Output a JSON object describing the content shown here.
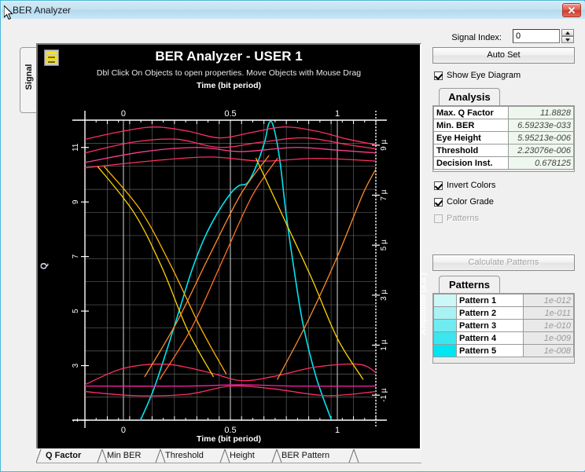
{
  "window": {
    "title": "BER Analyzer",
    "close_label": "Close",
    "accent_border": "#4ab8d8"
  },
  "left_tab": {
    "label": "Signal"
  },
  "plot": {
    "icon_name": "legend-properties-icon",
    "title": "BER Analyzer - USER 1",
    "subtitle": "Dbl Click On Objects to open properties.  Move Objects with Mouse Drag",
    "axis_top_title": "Time (bit period)",
    "axis_bottom_title": "Time (bit period)",
    "axis_left_title": "Q",
    "axis_right_title": "Amplitude (a.u.)",
    "background": "#000000",
    "grid_color": "#707070",
    "xticks": [
      "0",
      "0.5",
      "1"
    ],
    "yticks_left": [
      "1",
      "3",
      "5",
      "7",
      "9",
      "11"
    ],
    "yticks_right": [
      "-1 µ",
      "1 µ",
      "3 µ",
      "5 µ",
      "7 µ",
      "9 µ"
    ]
  },
  "chart_data": {
    "type": "line",
    "title": "BER Analyzer - USER 1",
    "subtitle": "Dbl Click On Objects to open properties.  Move Objects with Mouse Drag",
    "xlabel": "Time (bit period)",
    "ylabel": "Q",
    "y2label": "Amplitude (a.u.)",
    "xlim": [
      -0.18,
      1.18
    ],
    "ylim": [
      1,
      12
    ],
    "y2lim": [
      -2.0,
      10.0
    ],
    "xticks": [
      0,
      0.5,
      1
    ],
    "yticks": [
      1,
      3,
      5,
      7,
      9,
      11
    ],
    "y2ticks": [
      -1,
      1,
      3,
      5,
      7,
      9
    ],
    "grid": true,
    "legend": "none",
    "series": [
      {
        "name": "q-factor-curve",
        "color": "#00e5ee",
        "x": [
          0.08,
          0.14,
          0.2,
          0.26,
          0.32,
          0.38,
          0.44,
          0.5,
          0.54,
          0.58,
          0.62,
          0.66,
          0.68,
          0.7,
          0.73,
          0.76,
          0.8,
          0.84,
          0.9,
          0.97
        ],
        "y": [
          1.0,
          2.1,
          3.5,
          5.0,
          6.5,
          7.7,
          8.6,
          9.3,
          9.6,
          9.7,
          10.3,
          11.2,
          11.88,
          11.8,
          10.6,
          8.6,
          6.4,
          4.5,
          2.6,
          1.05
        ]
      },
      {
        "name": "eye-upper-rail-1",
        "color": "#ff2e63",
        "x": [
          -0.18,
          0.0,
          0.15,
          0.3,
          0.45,
          0.6,
          0.75,
          0.9,
          1.05,
          1.18
        ],
        "y": [
          11.3,
          11.6,
          11.75,
          11.6,
          11.35,
          11.55,
          11.75,
          11.6,
          11.3,
          11.1
        ]
      },
      {
        "name": "eye-upper-rail-2",
        "color": "#ff2e63",
        "x": [
          -0.18,
          0.05,
          0.25,
          0.45,
          0.65,
          0.85,
          1.05,
          1.18
        ],
        "y": [
          10.8,
          11.2,
          11.3,
          11.0,
          11.2,
          11.35,
          11.1,
          10.95
        ]
      },
      {
        "name": "eye-upper-rail-3",
        "color": "#ff3d8f",
        "x": [
          -0.18,
          0.1,
          0.35,
          0.55,
          0.8,
          1.0,
          1.18
        ],
        "y": [
          10.45,
          10.85,
          11.0,
          10.85,
          11.0,
          10.9,
          10.8
        ]
      },
      {
        "name": "eye-upper-rail-4",
        "color": "#ff2e63",
        "x": [
          -0.18,
          0.12,
          0.4,
          0.65,
          0.9,
          1.18
        ],
        "y": [
          10.25,
          10.5,
          10.65,
          10.5,
          10.6,
          10.5
        ]
      },
      {
        "name": "eye-lower-rail-1",
        "color": "#ff2e63",
        "x": [
          -0.18,
          0.0,
          0.2,
          0.4,
          0.55,
          0.7,
          0.9,
          1.1,
          1.18
        ],
        "y": [
          2.3,
          2.9,
          3.05,
          2.75,
          2.45,
          2.6,
          2.95,
          3.05,
          2.75
        ]
      },
      {
        "name": "eye-lower-rail-2",
        "color": "#ff2e63",
        "x": [
          -0.18,
          0.05,
          0.3,
          0.5,
          0.7,
          0.95,
          1.18
        ],
        "y": [
          2.05,
          1.9,
          1.95,
          2.25,
          2.15,
          1.9,
          2.05
        ]
      },
      {
        "name": "eye-lower-rail-3",
        "color": "#ff22aa",
        "x": [
          -0.18,
          0.3,
          0.55,
          0.8,
          1.18
        ],
        "y": [
          2.25,
          2.25,
          2.3,
          2.25,
          2.25
        ]
      },
      {
        "name": "eye-crossing-fall-1",
        "color": "#ffd400",
        "x": [
          -0.12,
          0.05,
          0.18,
          0.3,
          0.42
        ],
        "y": [
          10.3,
          8.6,
          6.6,
          4.3,
          2.6
        ]
      },
      {
        "name": "eye-crossing-fall-2",
        "color": "#ffb100",
        "x": [
          -0.09,
          0.08,
          0.22,
          0.36,
          0.48
        ],
        "y": [
          10.3,
          8.7,
          6.7,
          4.4,
          2.7
        ]
      },
      {
        "name": "eye-crossing-rise-1",
        "color": "#ff8c2a",
        "x": [
          0.1,
          0.25,
          0.4,
          0.55,
          0.68
        ],
        "y": [
          2.6,
          4.6,
          7.0,
          9.3,
          10.7
        ]
      },
      {
        "name": "eye-crossing-rise-2",
        "color": "#ff7020",
        "x": [
          0.17,
          0.32,
          0.46,
          0.6,
          0.72
        ],
        "y": [
          2.5,
          4.4,
          6.8,
          9.2,
          10.6
        ]
      },
      {
        "name": "eye-crossing-fall-3",
        "color": "#ffd400",
        "x": [
          0.62,
          0.75,
          0.88,
          1.0,
          1.12
        ],
        "y": [
          10.6,
          8.4,
          6.2,
          4.0,
          2.5
        ]
      },
      {
        "name": "eye-crossing-rise-3",
        "color": "#ff8c2a",
        "x": [
          0.72,
          0.86,
          1.0,
          1.12,
          1.18
        ],
        "y": [
          2.5,
          4.6,
          7.0,
          9.3,
          10.2
        ]
      }
    ]
  },
  "bottom_tabs": [
    {
      "label": "Q Factor",
      "active": true
    },
    {
      "label": "Min BER",
      "active": false
    },
    {
      "label": "Threshold",
      "active": false
    },
    {
      "label": "Height",
      "active": false
    },
    {
      "label": "BER Pattern",
      "active": false
    }
  ],
  "right_panel": {
    "signal_index_label": "Signal Index:",
    "signal_index_value": "0",
    "spinner_up": "increment",
    "spinner_down": "decrement",
    "auto_set_label": "Auto Set",
    "show_eye_label": "Show Eye Diagram",
    "show_eye_checked": true,
    "analysis_tab_label": "Analysis",
    "analysis_rows": [
      {
        "key": "Max. Q Factor",
        "value": "11.8828"
      },
      {
        "key": "Min. BER",
        "value": "6.59233e-033"
      },
      {
        "key": "Eye Height",
        "value": "5.95213e-006"
      },
      {
        "key": "Threshold",
        "value": "2.23076e-006"
      },
      {
        "key": "Decision Inst.",
        "value": "0.678125"
      }
    ],
    "invert_colors_label": "Invert Colors",
    "invert_colors_checked": true,
    "color_grade_label": "Color Grade",
    "color_grade_checked": true,
    "patterns_check_label": "Patterns",
    "patterns_check_checked": false,
    "calculate_patterns_label": "Calculate Patterns",
    "patterns_tab_label": "Patterns",
    "pattern_rows": [
      {
        "label": "Pattern 1",
        "value": "1e-012",
        "color": "#ccf7f7"
      },
      {
        "label": "Pattern 2",
        "value": "1e-011",
        "color": "#a8f2f4"
      },
      {
        "label": "Pattern 3",
        "value": "1e-010",
        "color": "#70ecf0"
      },
      {
        "label": "Pattern 4",
        "value": "1e-009",
        "color": "#3ae6ef"
      },
      {
        "label": "Pattern 5",
        "value": "1e-008",
        "color": "#00e5f2"
      }
    ]
  }
}
